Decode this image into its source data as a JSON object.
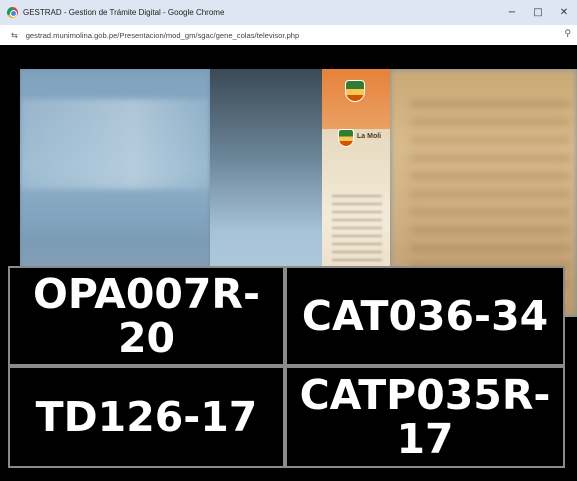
{
  "browser": {
    "window_title": "GESTRAD - Gestion de Trámite Digital - Google Chrome",
    "url": "gestrad.munimolina.gob.pe/Presentacion/mod_gm/sgac/gene_colas/televisor.php",
    "controls": {
      "minimize": "−",
      "maximize": "□",
      "close": "✕"
    },
    "icons": {
      "site_settings": "⇆",
      "zoom": "⚲"
    }
  },
  "video": {
    "banner_text": "La Moli"
  },
  "tickets": [
    {
      "code": "OPA007R-20"
    },
    {
      "code": "CAT036-34"
    },
    {
      "code": "TD126-17"
    },
    {
      "code": "CATP035R-17"
    }
  ],
  "colors": {
    "ticket_background": "#000000",
    "ticket_text": "#ffffff",
    "ticket_border": "#8a8a8a",
    "titlebar": "#dfe6f3"
  }
}
